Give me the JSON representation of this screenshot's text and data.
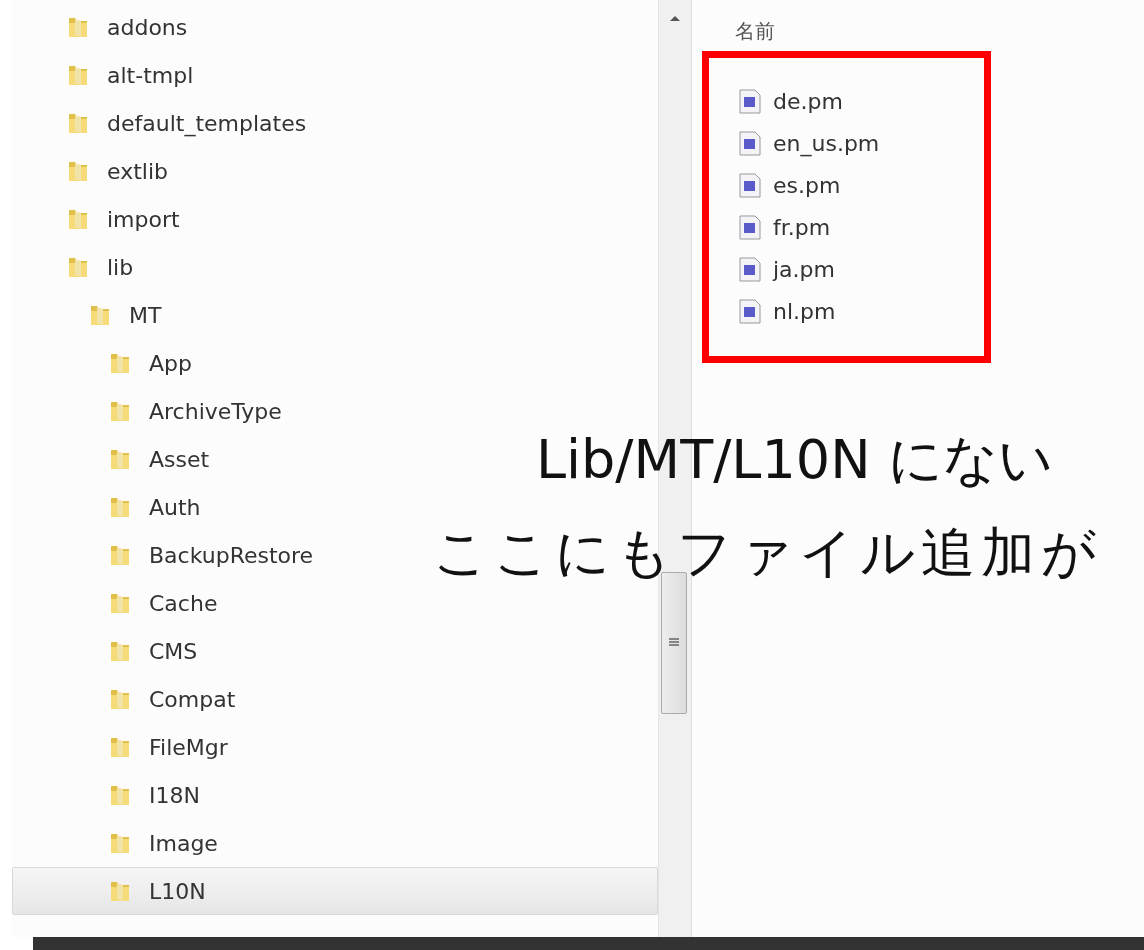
{
  "tree": [
    {
      "label": "addons",
      "selected": false
    },
    {
      "label": "alt-tmpl",
      "selected": false
    },
    {
      "label": "default_templates",
      "selected": false
    },
    {
      "label": "extlib",
      "selected": false
    },
    {
      "label": "import",
      "selected": false
    },
    {
      "label": "lib",
      "selected": false,
      "children": [
        {
          "label": "MT",
          "selected": false,
          "children": [
            {
              "label": "App",
              "selected": false
            },
            {
              "label": "ArchiveType",
              "selected": false
            },
            {
              "label": "Asset",
              "selected": false
            },
            {
              "label": "Auth",
              "selected": false
            },
            {
              "label": "BackupRestore",
              "selected": false
            },
            {
              "label": "Cache",
              "selected": false
            },
            {
              "label": "CMS",
              "selected": false
            },
            {
              "label": "Compat",
              "selected": false
            },
            {
              "label": "FileMgr",
              "selected": false
            },
            {
              "label": "I18N",
              "selected": false
            },
            {
              "label": "Image",
              "selected": false
            },
            {
              "label": "L10N",
              "selected": true
            }
          ]
        }
      ]
    }
  ],
  "file_list": {
    "column": "名前",
    "files": [
      "de.pm",
      "en_us.pm",
      "es.pm",
      "fr.pm",
      "ja.pm",
      "nl.pm"
    ]
  },
  "caption": [
    "Lib/MT/L10N にない",
    "ここにもファイル追加が"
  ]
}
